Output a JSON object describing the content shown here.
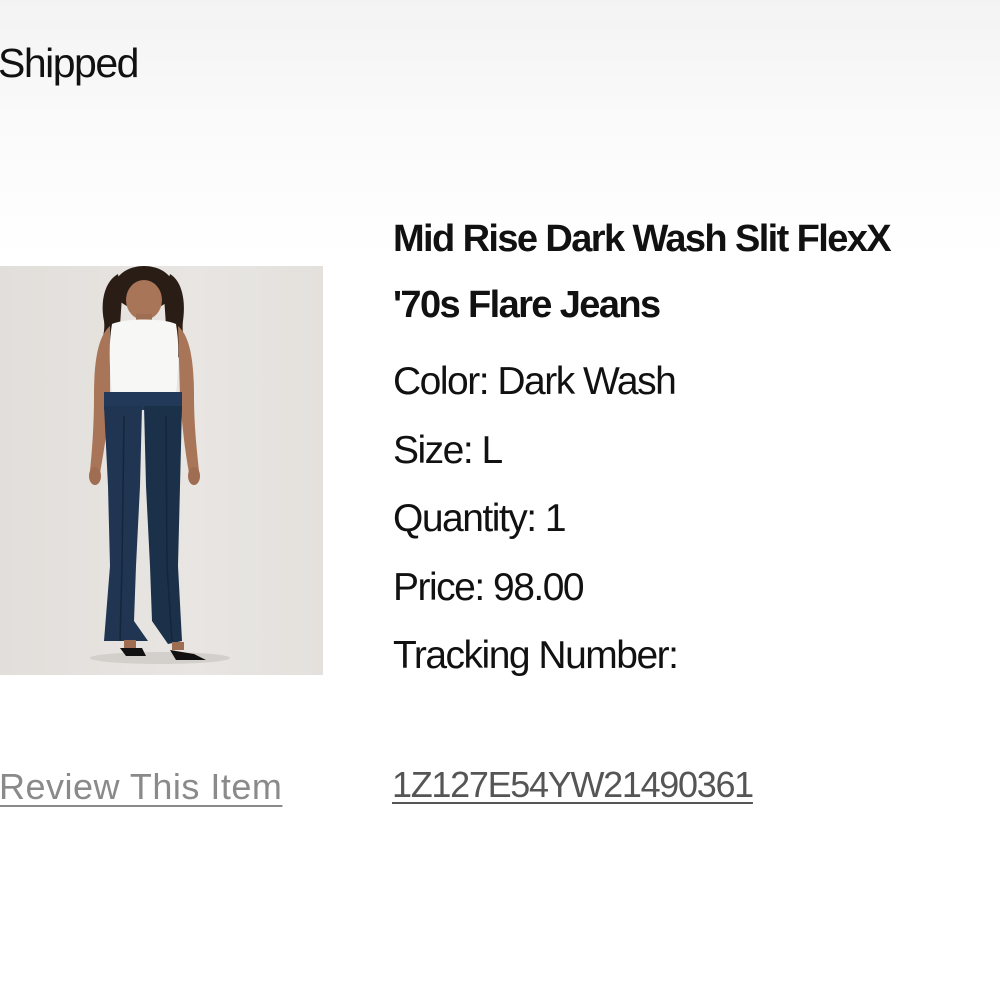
{
  "order": {
    "status": "Shipped"
  },
  "item": {
    "image_alt": "Model wearing dark wash flare jeans with white sleeveless top",
    "title_line1": "Mid Rise Dark Wash Slit FlexX",
    "title_line2": "'70s Flare Jeans",
    "color": "Color: Dark Wash",
    "size": "Size: L",
    "quantity": "Quantity: 1",
    "price": "Price: 98.00",
    "tracking_label": "Tracking Number:",
    "tracking_number": "1Z127E54YW21490361",
    "review_label": "Review This Item"
  },
  "colors": {
    "text": "#111111",
    "review_link": "#8a8a8a",
    "tracking_link": "#555555",
    "denim": "#1f3551",
    "image_bg": "#e5e2de"
  }
}
